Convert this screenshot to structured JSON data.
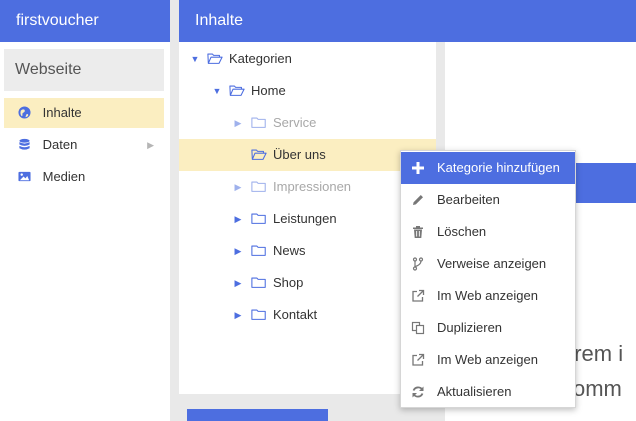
{
  "app": {
    "title": "firstvoucher"
  },
  "sidebar": {
    "section_title": "Webseite",
    "items": [
      {
        "label": "Inhalte",
        "icon": "globe-icon",
        "active": true
      },
      {
        "label": "Daten",
        "icon": "database-icon",
        "has_submenu": true
      },
      {
        "label": "Medien",
        "icon": "image-icon"
      }
    ]
  },
  "content": {
    "title": "Inhalte"
  },
  "tree": {
    "nodes": [
      {
        "label": "Kategorien",
        "expanded": true
      },
      {
        "label": "Home",
        "expanded": true
      },
      {
        "label": "Service",
        "dimmed": true
      },
      {
        "label": "Über uns",
        "selected": true
      },
      {
        "label": "Impressionen",
        "dimmed": true
      },
      {
        "label": "Leistungen"
      },
      {
        "label": "News"
      },
      {
        "label": "Shop"
      },
      {
        "label": "Kontakt"
      }
    ]
  },
  "context_menu": {
    "items": [
      {
        "label": "Kategorie hinzufügen",
        "icon": "plus-icon",
        "highlighted": true
      },
      {
        "label": "Bearbeiten",
        "icon": "pencil-icon"
      },
      {
        "label": "Löschen",
        "icon": "trash-icon"
      },
      {
        "label": "Verweise anzeigen",
        "icon": "branch-icon"
      },
      {
        "label": "Im Web anzeigen",
        "icon": "external-link-icon"
      },
      {
        "label": "Duplizieren",
        "icon": "copy-icon"
      },
      {
        "label": "Im Web anzeigen",
        "icon": "external-link-icon"
      },
      {
        "label": "Aktualisieren",
        "icon": "refresh-icon"
      }
    ]
  },
  "preview": {
    "line1": "orem i",
    "line2": "comm"
  },
  "colors": {
    "brand": "#4d6ee0",
    "selection": "#fbeec1"
  }
}
